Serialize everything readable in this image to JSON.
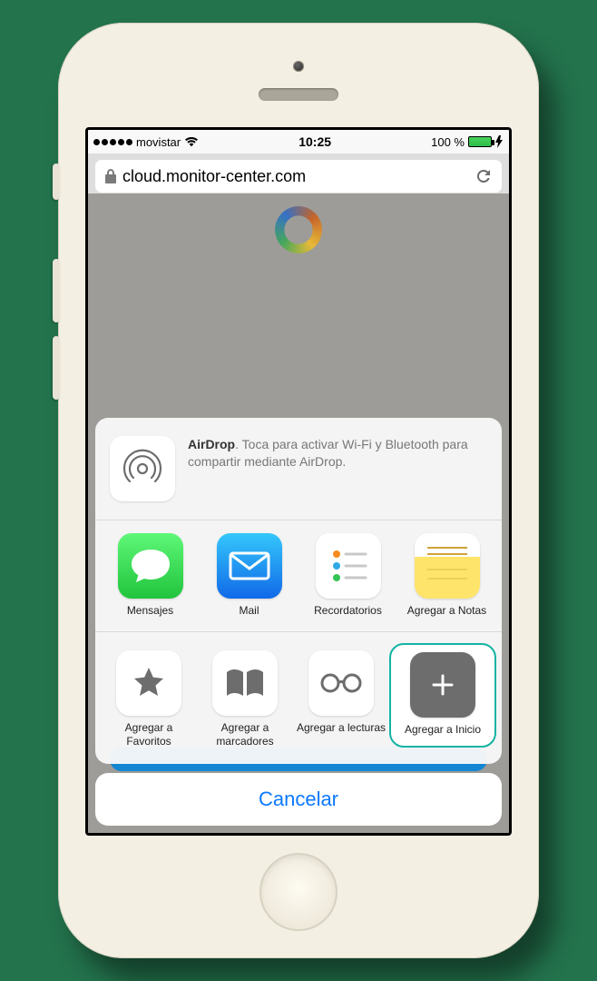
{
  "statusbar": {
    "carrier": "movistar",
    "time": "10:25",
    "battery_pct": "100 %"
  },
  "urlbar": {
    "domain": "cloud.monitor-center.com"
  },
  "airdrop": {
    "title": "AirDrop",
    "desc": ". Toca para activar Wi-Fi y Bluetooth para compartir mediante AirDrop."
  },
  "apps": {
    "messages": "Mensajes",
    "mail": "Mail",
    "reminders": "Recordatorios",
    "notes": "Agregar a Notas"
  },
  "actions": {
    "favorites": "Agregar a Favoritos",
    "bookmarks": "Agregar a marcadores",
    "reading": "Agregar a lecturas",
    "home": "Agregar a Inicio"
  },
  "cancel": "Cancelar"
}
